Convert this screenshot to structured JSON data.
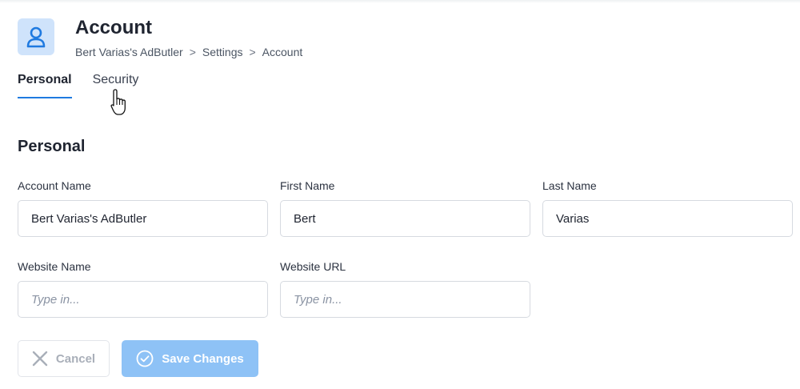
{
  "header": {
    "title": "Account",
    "breadcrumb": [
      "Bert Varias's AdButler",
      "Settings",
      "Account"
    ],
    "breadcrumb_separator": ">",
    "avatar_icon": "user-icon",
    "avatar_bg": "#cfe3fb",
    "avatar_fg": "#1f7ae0"
  },
  "tabs": [
    {
      "label": "Personal",
      "active": true
    },
    {
      "label": "Security",
      "active": false
    }
  ],
  "section": {
    "title": "Personal"
  },
  "fields": {
    "account_name": {
      "label": "Account Name",
      "value": "Bert Varias's AdButler",
      "placeholder": ""
    },
    "first_name": {
      "label": "First Name",
      "value": "Bert",
      "placeholder": ""
    },
    "last_name": {
      "label": "Last Name",
      "value": "Varias",
      "placeholder": ""
    },
    "website_name": {
      "label": "Website Name",
      "value": "",
      "placeholder": "Type in..."
    },
    "website_url": {
      "label": "Website URL",
      "value": "",
      "placeholder": "Type in..."
    }
  },
  "buttons": {
    "cancel": {
      "label": "Cancel",
      "icon": "close-icon"
    },
    "save": {
      "label": "Save Changes",
      "icon": "check-circle-icon"
    }
  },
  "colors": {
    "accent": "#1f7ae0",
    "save_button": "#8ec2f6"
  }
}
